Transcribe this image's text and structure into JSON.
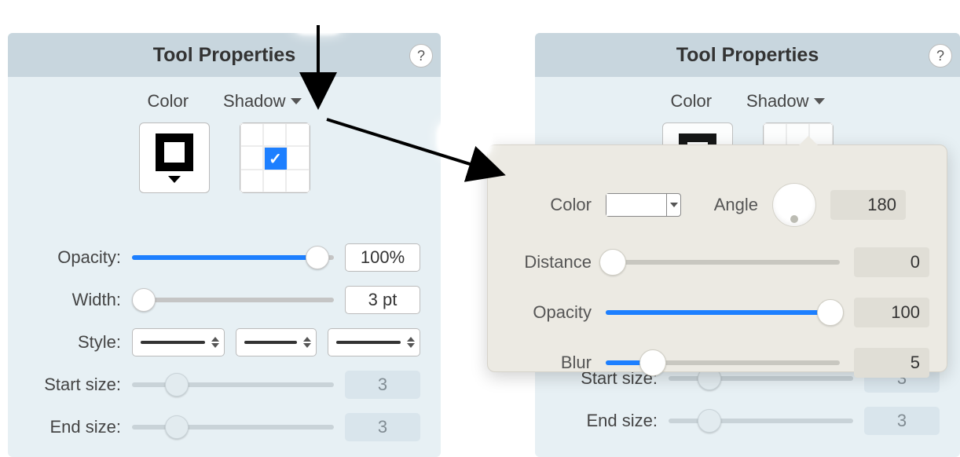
{
  "left": {
    "title": "Tool Properties",
    "help": "?",
    "tabs": {
      "color": "Color",
      "shadow": "Shadow"
    },
    "rows": {
      "opacity": {
        "label": "Opacity:",
        "value": "100%",
        "pct": 92
      },
      "width": {
        "label": "Width:",
        "value": "3 pt",
        "pct": 6
      },
      "style": {
        "label": "Style:"
      },
      "start": {
        "label": "Start size:",
        "value": "3",
        "pct": 22
      },
      "end": {
        "label": "End size:",
        "value": "3",
        "pct": 22
      }
    }
  },
  "right": {
    "title": "Tool Properties",
    "help": "?",
    "tabs": {
      "color": "Color",
      "shadow": "Shadow"
    },
    "rows": {
      "start": {
        "label": "Start size:",
        "value": "3"
      },
      "end": {
        "label": "End size:",
        "value": "3"
      }
    }
  },
  "popover": {
    "color": {
      "label": "Color"
    },
    "angle": {
      "label": "Angle",
      "value": "180"
    },
    "distance": {
      "label": "Distance",
      "value": "0",
      "pct": 0
    },
    "opacity": {
      "label": "Opacity",
      "value": "100",
      "pct": 96
    },
    "blur": {
      "label": "Blur",
      "value": "5",
      "pct": 20
    }
  }
}
